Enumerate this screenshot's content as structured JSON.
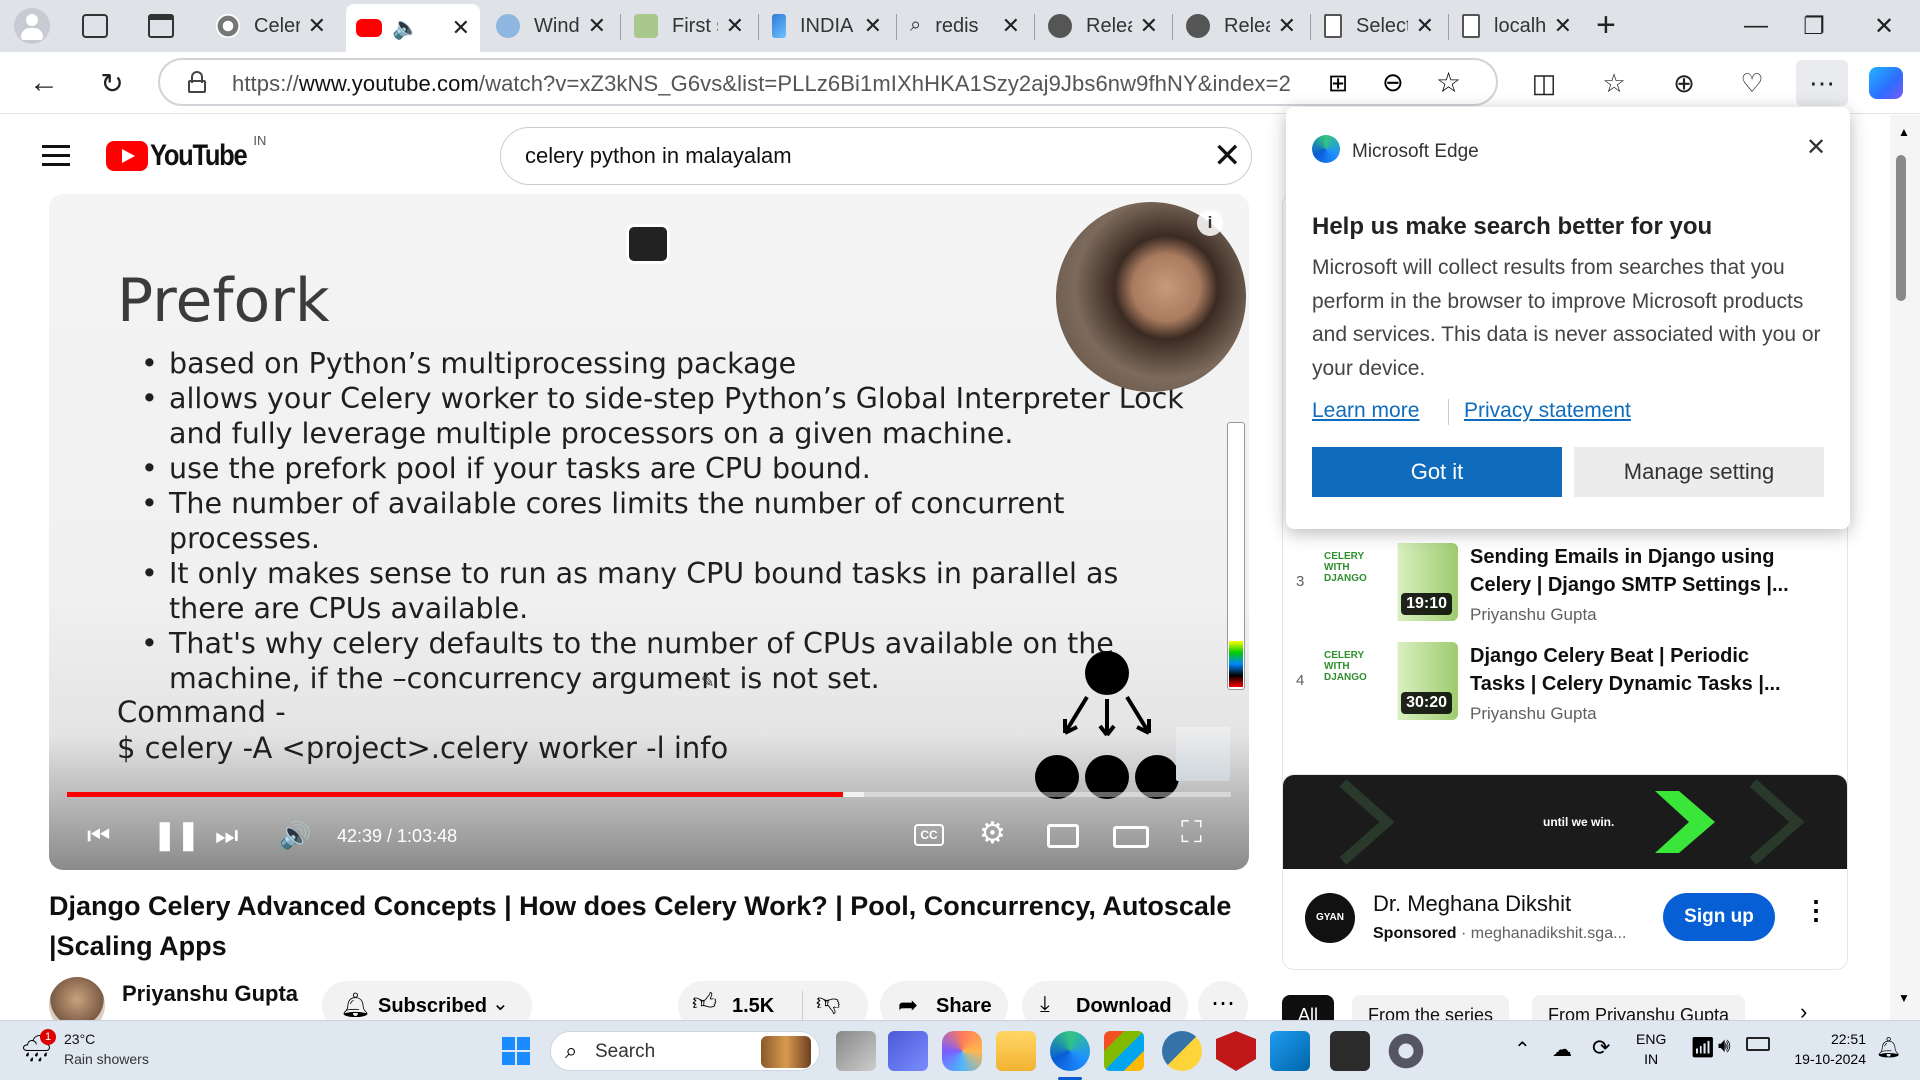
{
  "browser": {
    "tabs": [
      {
        "label": "Celery",
        "active": false
      },
      {
        "label": "",
        "active": true
      },
      {
        "label": "Windows",
        "active": false
      },
      {
        "label": "First steps",
        "active": false
      },
      {
        "label": "INDIA",
        "active": false
      },
      {
        "label": "redis",
        "active": false
      },
      {
        "label": "Releases",
        "active": false
      },
      {
        "label": "Releases",
        "active": false
      },
      {
        "label": "Select",
        "active": false
      },
      {
        "label": "localhost",
        "active": false
      }
    ],
    "url_prefix": "https://",
    "url_domain": "www.youtube.com",
    "url_path": "/watch?v=xZ3kNS_G6vs&list=PLLz6Bi1mIXhHKA1Szy2aj9Jbs6nw9fhNY&index=2"
  },
  "youtube": {
    "logo_text": "YouTube",
    "country": "IN",
    "search_value": "celery python in malayalam",
    "slide": {
      "title": "Prefork",
      "bullets": [
        "based on Python’s multiprocessing package",
        "allows your Celery worker to side-step Python’s Global Interpreter Lock and fully leverage multiple processors on a given machine.",
        "use the prefork pool if your tasks are CPU bound.",
        "The number of available cores limits the number of concurrent processes.",
        "It only makes sense to run as many CPU bound tasks in parallel as there are CPUs available.",
        "That's why celery defaults to the number of CPUs available on the machine, if the –concurrency argument is not set."
      ],
      "command_label": "Command -",
      "command": "$ celery -A <project>.celery worker -l info"
    },
    "player": {
      "time": "42:39 / 1:03:48",
      "progress": 0.667,
      "buffered": 0.685
    },
    "video_title": "Django Celery Advanced Concepts | How does Celery Work? | Pool, Concurrency, Autoscale |Scaling Apps",
    "channel_name": "Priyanshu Gupta",
    "subscribed_label": "Subscribed",
    "likes": "1.5K",
    "share_label": "Share",
    "download_label": "Download"
  },
  "edge_popup": {
    "brand": "Microsoft Edge",
    "heading": "Help us make search better for you",
    "body": "Microsoft will collect results from searches that you perform in the browser to improve Microsoft products and services. This data is never associated with you or your device.",
    "learn_more": "Learn more",
    "privacy": "Privacy statement",
    "got_it": "Got it",
    "manage": "Manage setting"
  },
  "playlist": [
    {
      "index": "3",
      "title": "Sending Emails in Django using Celery | Django SMTP Settings |...",
      "channel": "Priyanshu Gupta",
      "duration": "19:10",
      "thumb_text": "CELERY WITH DJANGO"
    },
    {
      "index": "4",
      "title": "Django Celery Beat | Periodic Tasks | Celery Dynamic Tasks |...",
      "channel": "Priyanshu Gupta",
      "duration": "30:20",
      "thumb_text": "CELERY WITH DJANGO"
    }
  ],
  "ad": {
    "banner_text": "until we win.",
    "name": "Dr. Meghana Dikshit",
    "sponsored": "Sponsored",
    "domain": "meghanadikshit.sga...",
    "logo_text": "GYAN",
    "cta": "Sign up"
  },
  "chips": [
    "All",
    "From the series",
    "From Priyanshu Gupta"
  ],
  "taskbar": {
    "weather_temp": "23°C",
    "weather_desc": "Rain showers",
    "weather_badge": "1",
    "search_placeholder": "Search",
    "lang": "ENG",
    "region": "IN",
    "time": "22:51",
    "date": "19-10-2024"
  }
}
